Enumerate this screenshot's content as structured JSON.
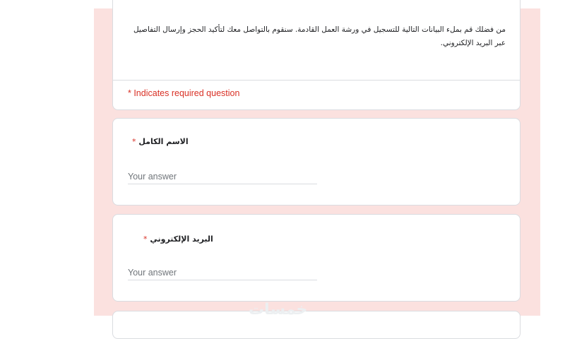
{
  "form": {
    "description": "من فضلك قم بملء البيانات التالية للتسجيل في ورشة العمل القادمة. سنقوم بالتواصل معك لتأكيد الحجز وإرسال التفاصيل عبر البريد الإلكتروني.",
    "required_note": "* Indicates required question"
  },
  "questions": [
    {
      "title": "الاسم الكامل",
      "required_mark": "*",
      "placeholder": "Your answer"
    },
    {
      "title": "البريد الإلكتروني",
      "required_mark": "*",
      "placeholder": "Your answer"
    }
  ],
  "watermark": "خمسات",
  "colors": {
    "background_tint": "#fbe1df",
    "required": "#d93025",
    "border": "#dadce0"
  }
}
